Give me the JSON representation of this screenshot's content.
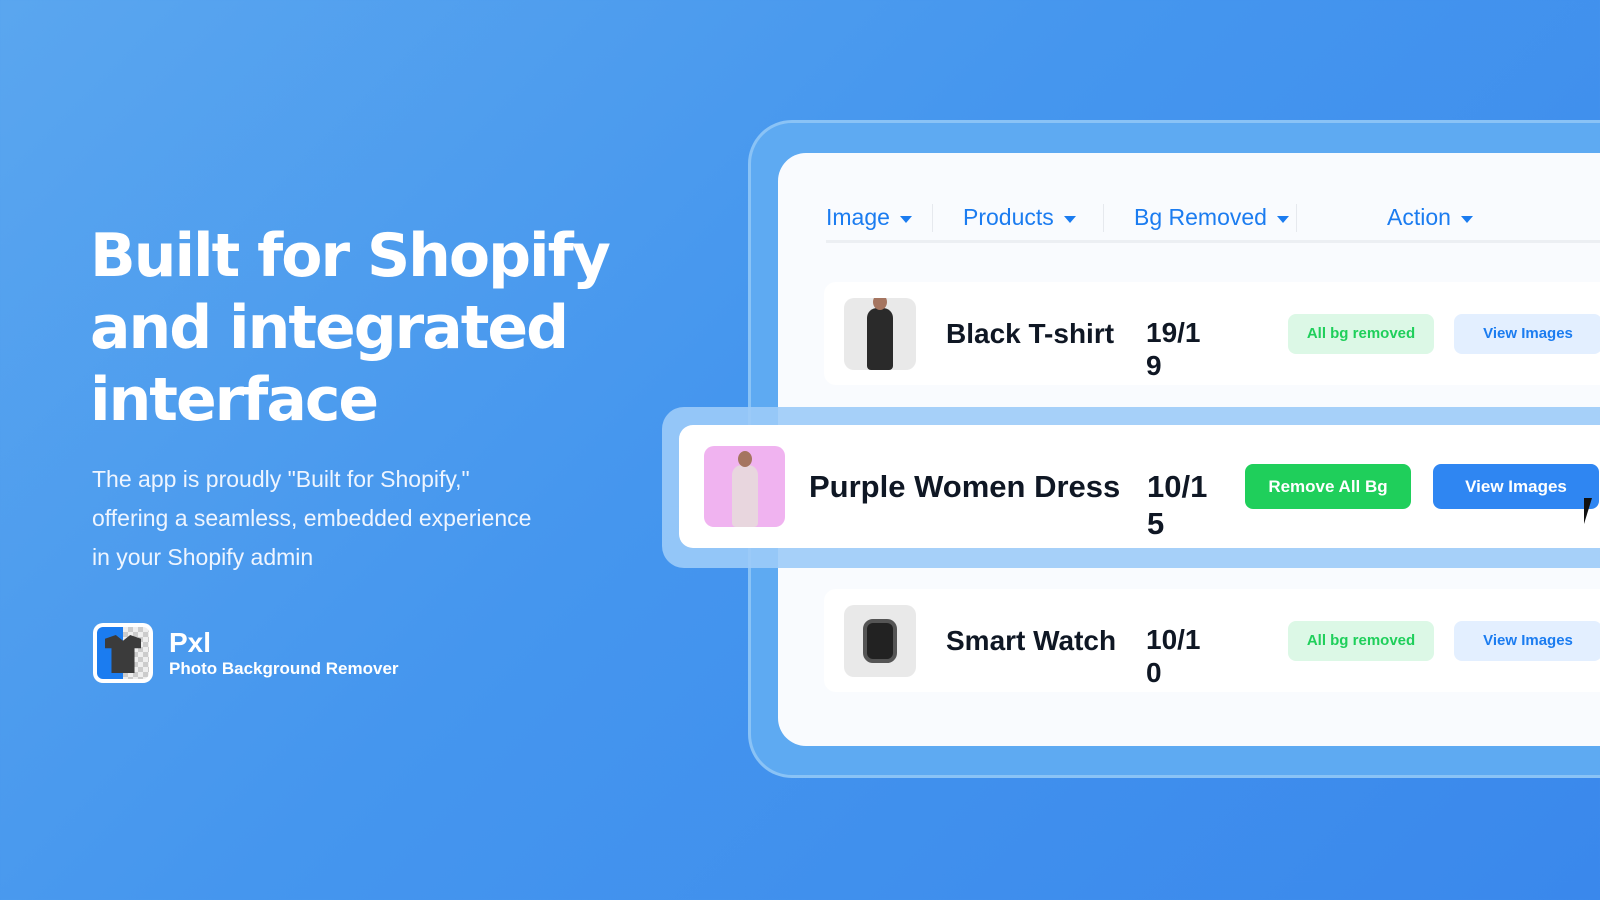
{
  "hero": {
    "headline": "Built for Shopify and integrated interface",
    "description": "The app is proudly \"Built for Shopify,\" offering a seamless, embedded experience in your Shopify admin"
  },
  "brand": {
    "name": "Pxl",
    "tagline": "Photo Background Remover",
    "icon": "tshirt-transparent-logo"
  },
  "table": {
    "columns": [
      {
        "label": "Image"
      },
      {
        "label": "Products"
      },
      {
        "label": "Bg Removed"
      },
      {
        "label": "Action"
      }
    ],
    "rows": [
      {
        "product": "Black T-shirt",
        "bg_removed": "19/19",
        "status": "All bg removed",
        "action": "View Images"
      },
      {
        "product": "Purple Women Dress",
        "bg_removed": "10/15",
        "status": "Remove All Bg",
        "action": "View Images"
      },
      {
        "product": "Smart Watch",
        "bg_removed": "10/10",
        "status": "All bg removed",
        "action": "View Images"
      }
    ]
  },
  "colors": {
    "accent": "#1b7cf0",
    "success": "#1fcf5b",
    "success_bg": "#dcf8e6",
    "info_bg": "#e3efff"
  }
}
